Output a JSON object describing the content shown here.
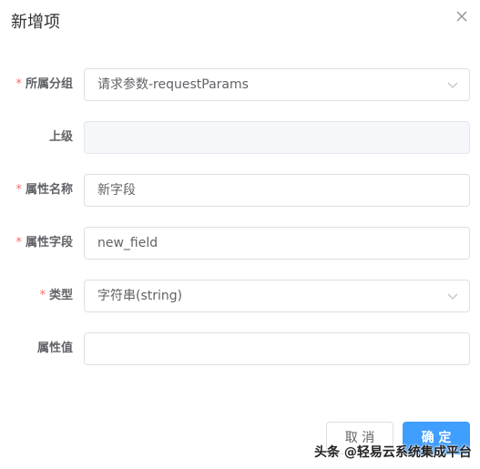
{
  "dialog": {
    "title": "新增项",
    "close_icon": "close-icon"
  },
  "form": {
    "group": {
      "required": "*",
      "label": "所属分组",
      "value": "请求参数-requestParams",
      "icon": "chevron-down-icon"
    },
    "parent": {
      "label": "上级",
      "value": ""
    },
    "attr_name": {
      "required": "*",
      "label": "属性名称",
      "value": "新字段"
    },
    "attr_field": {
      "required": "*",
      "label": "属性字段",
      "value": "new_field"
    },
    "type": {
      "required": "*",
      "label": "类型",
      "value": "字符串(string)",
      "icon": "chevron-down-icon"
    },
    "attr_value": {
      "label": "属性值",
      "value": ""
    }
  },
  "footer": {
    "cancel_label": "取 消",
    "ok_label": "确 定"
  },
  "watermark": "头条 @轻易云系统集成平台",
  "colors": {
    "required": "#f56c6c",
    "primary": "#409eff",
    "border": "#dcdfe6",
    "disabled_bg": "#f5f7fa"
  }
}
